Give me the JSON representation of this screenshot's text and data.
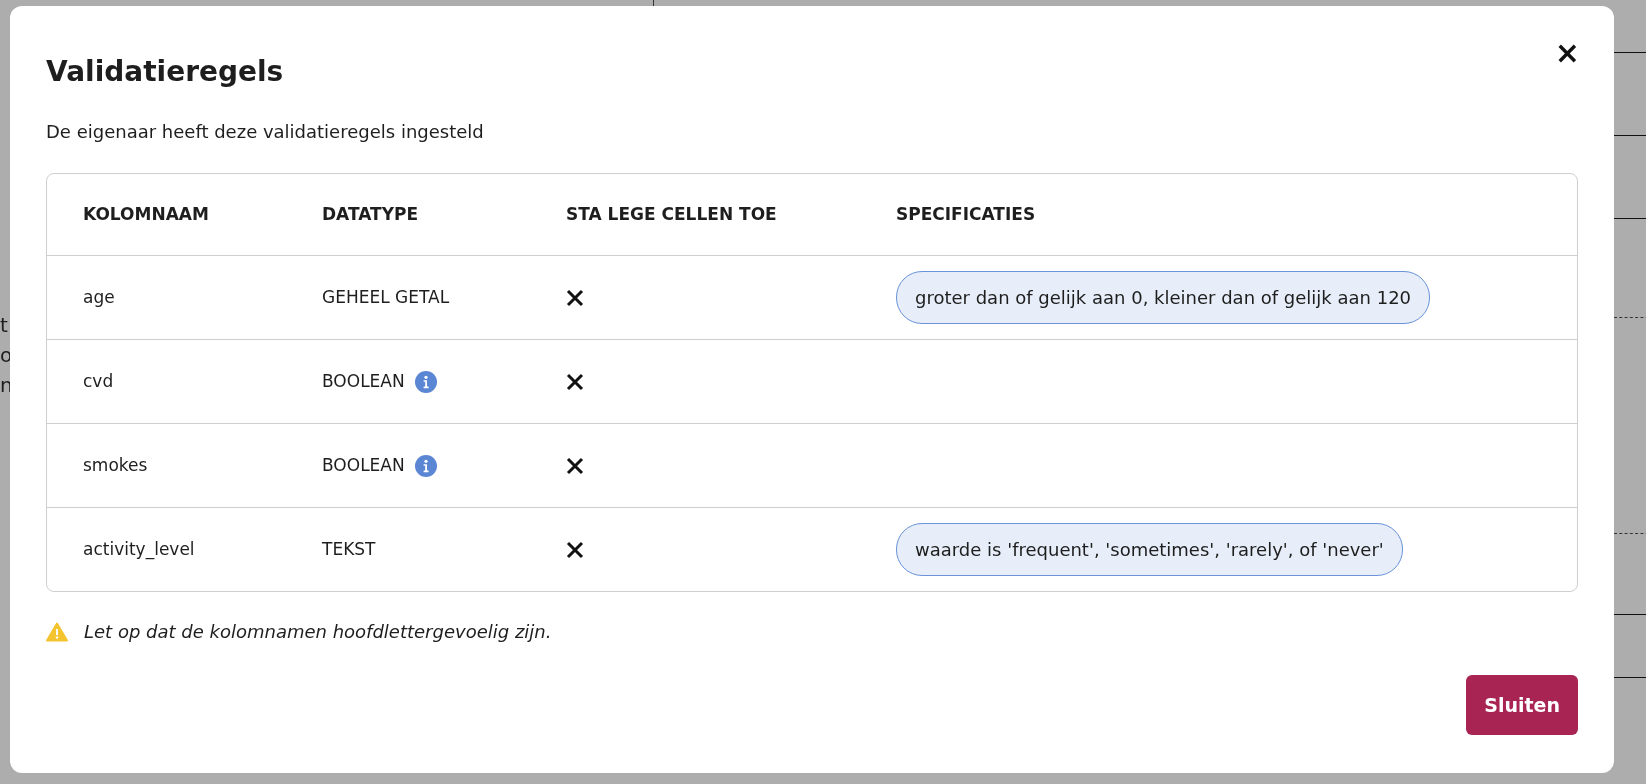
{
  "background": {
    "side_letters": [
      "t",
      "o",
      "n"
    ]
  },
  "dialog": {
    "title": "Validatieregels",
    "close_label": "×",
    "subtitle": "De eigenaar heeft deze validatieregels ingesteld",
    "table": {
      "columns": [
        "KOLOMNAAM",
        "DATATYPE",
        "STA LEGE CELLEN TOE",
        "SPECIFICATIES"
      ],
      "rows": [
        {
          "name": "age",
          "datatype": "GEHEEL GETAL",
          "info": false,
          "allow_empty": false,
          "spec": "groter dan of gelijk aan 0, kleiner dan of gelijk aan 120"
        },
        {
          "name": "cvd",
          "datatype": "BOOLEAN",
          "info": true,
          "allow_empty": false
        },
        {
          "name": "smokes",
          "datatype": "BOOLEAN",
          "info": true,
          "allow_empty": false
        },
        {
          "name": "activity_level",
          "datatype": "TEKST",
          "info": false,
          "allow_empty": false,
          "spec": "waarde is 'frequent', 'sometimes', 'rarely', of 'never'"
        }
      ]
    },
    "warning": "Let op dat de kolomnamen hoofdlettergevoelig zijn.",
    "button": "Sluiten"
  }
}
